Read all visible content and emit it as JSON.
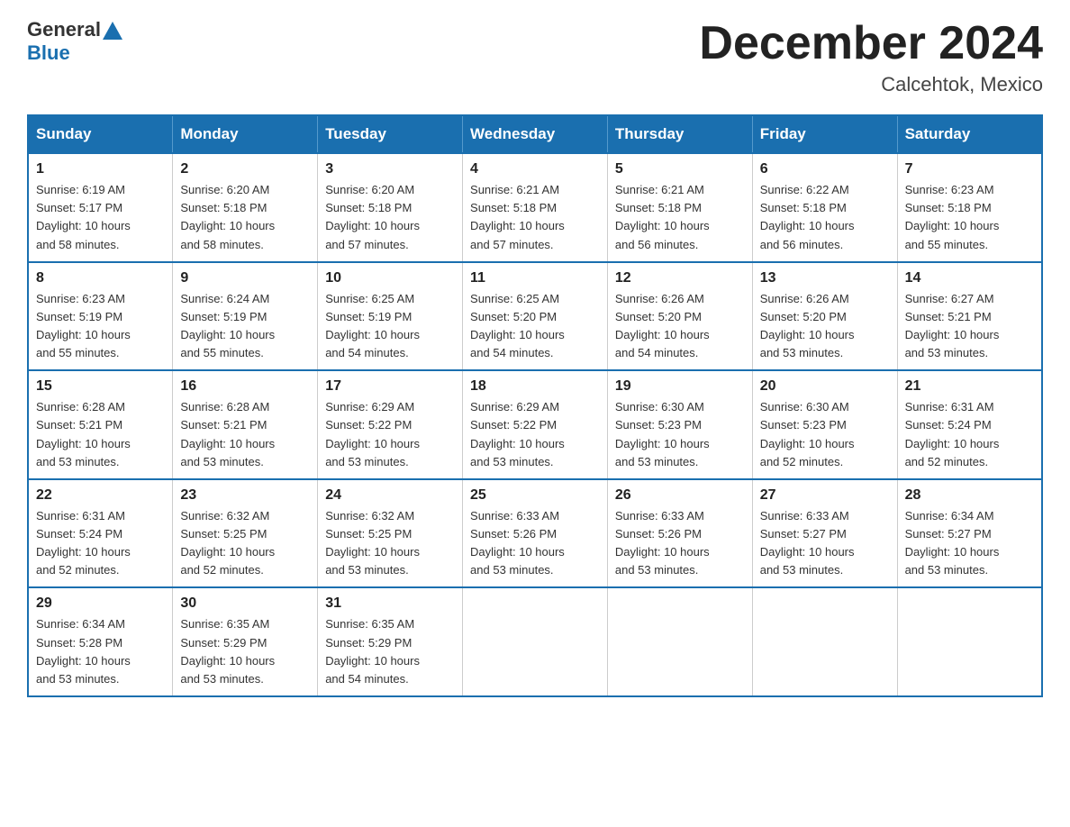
{
  "header": {
    "logo_general": "General",
    "logo_blue": "Blue",
    "month_title": "December 2024",
    "location": "Calcehtok, Mexico"
  },
  "weekdays": [
    "Sunday",
    "Monday",
    "Tuesday",
    "Wednesday",
    "Thursday",
    "Friday",
    "Saturday"
  ],
  "weeks": [
    [
      {
        "day": "1",
        "sunrise": "6:19 AM",
        "sunset": "5:17 PM",
        "daylight": "10 hours and 58 minutes."
      },
      {
        "day": "2",
        "sunrise": "6:20 AM",
        "sunset": "5:18 PM",
        "daylight": "10 hours and 58 minutes."
      },
      {
        "day": "3",
        "sunrise": "6:20 AM",
        "sunset": "5:18 PM",
        "daylight": "10 hours and 57 minutes."
      },
      {
        "day": "4",
        "sunrise": "6:21 AM",
        "sunset": "5:18 PM",
        "daylight": "10 hours and 57 minutes."
      },
      {
        "day": "5",
        "sunrise": "6:21 AM",
        "sunset": "5:18 PM",
        "daylight": "10 hours and 56 minutes."
      },
      {
        "day": "6",
        "sunrise": "6:22 AM",
        "sunset": "5:18 PM",
        "daylight": "10 hours and 56 minutes."
      },
      {
        "day": "7",
        "sunrise": "6:23 AM",
        "sunset": "5:18 PM",
        "daylight": "10 hours and 55 minutes."
      }
    ],
    [
      {
        "day": "8",
        "sunrise": "6:23 AM",
        "sunset": "5:19 PM",
        "daylight": "10 hours and 55 minutes."
      },
      {
        "day": "9",
        "sunrise": "6:24 AM",
        "sunset": "5:19 PM",
        "daylight": "10 hours and 55 minutes."
      },
      {
        "day": "10",
        "sunrise": "6:25 AM",
        "sunset": "5:19 PM",
        "daylight": "10 hours and 54 minutes."
      },
      {
        "day": "11",
        "sunrise": "6:25 AM",
        "sunset": "5:20 PM",
        "daylight": "10 hours and 54 minutes."
      },
      {
        "day": "12",
        "sunrise": "6:26 AM",
        "sunset": "5:20 PM",
        "daylight": "10 hours and 54 minutes."
      },
      {
        "day": "13",
        "sunrise": "6:26 AM",
        "sunset": "5:20 PM",
        "daylight": "10 hours and 53 minutes."
      },
      {
        "day": "14",
        "sunrise": "6:27 AM",
        "sunset": "5:21 PM",
        "daylight": "10 hours and 53 minutes."
      }
    ],
    [
      {
        "day": "15",
        "sunrise": "6:28 AM",
        "sunset": "5:21 PM",
        "daylight": "10 hours and 53 minutes."
      },
      {
        "day": "16",
        "sunrise": "6:28 AM",
        "sunset": "5:21 PM",
        "daylight": "10 hours and 53 minutes."
      },
      {
        "day": "17",
        "sunrise": "6:29 AM",
        "sunset": "5:22 PM",
        "daylight": "10 hours and 53 minutes."
      },
      {
        "day": "18",
        "sunrise": "6:29 AM",
        "sunset": "5:22 PM",
        "daylight": "10 hours and 53 minutes."
      },
      {
        "day": "19",
        "sunrise": "6:30 AM",
        "sunset": "5:23 PM",
        "daylight": "10 hours and 53 minutes."
      },
      {
        "day": "20",
        "sunrise": "6:30 AM",
        "sunset": "5:23 PM",
        "daylight": "10 hours and 52 minutes."
      },
      {
        "day": "21",
        "sunrise": "6:31 AM",
        "sunset": "5:24 PM",
        "daylight": "10 hours and 52 minutes."
      }
    ],
    [
      {
        "day": "22",
        "sunrise": "6:31 AM",
        "sunset": "5:24 PM",
        "daylight": "10 hours and 52 minutes."
      },
      {
        "day": "23",
        "sunrise": "6:32 AM",
        "sunset": "5:25 PM",
        "daylight": "10 hours and 52 minutes."
      },
      {
        "day": "24",
        "sunrise": "6:32 AM",
        "sunset": "5:25 PM",
        "daylight": "10 hours and 53 minutes."
      },
      {
        "day": "25",
        "sunrise": "6:33 AM",
        "sunset": "5:26 PM",
        "daylight": "10 hours and 53 minutes."
      },
      {
        "day": "26",
        "sunrise": "6:33 AM",
        "sunset": "5:26 PM",
        "daylight": "10 hours and 53 minutes."
      },
      {
        "day": "27",
        "sunrise": "6:33 AM",
        "sunset": "5:27 PM",
        "daylight": "10 hours and 53 minutes."
      },
      {
        "day": "28",
        "sunrise": "6:34 AM",
        "sunset": "5:27 PM",
        "daylight": "10 hours and 53 minutes."
      }
    ],
    [
      {
        "day": "29",
        "sunrise": "6:34 AM",
        "sunset": "5:28 PM",
        "daylight": "10 hours and 53 minutes."
      },
      {
        "day": "30",
        "sunrise": "6:35 AM",
        "sunset": "5:29 PM",
        "daylight": "10 hours and 53 minutes."
      },
      {
        "day": "31",
        "sunrise": "6:35 AM",
        "sunset": "5:29 PM",
        "daylight": "10 hours and 54 minutes."
      },
      null,
      null,
      null,
      null
    ]
  ],
  "labels": {
    "sunrise": "Sunrise:",
    "sunset": "Sunset:",
    "daylight": "Daylight:"
  }
}
